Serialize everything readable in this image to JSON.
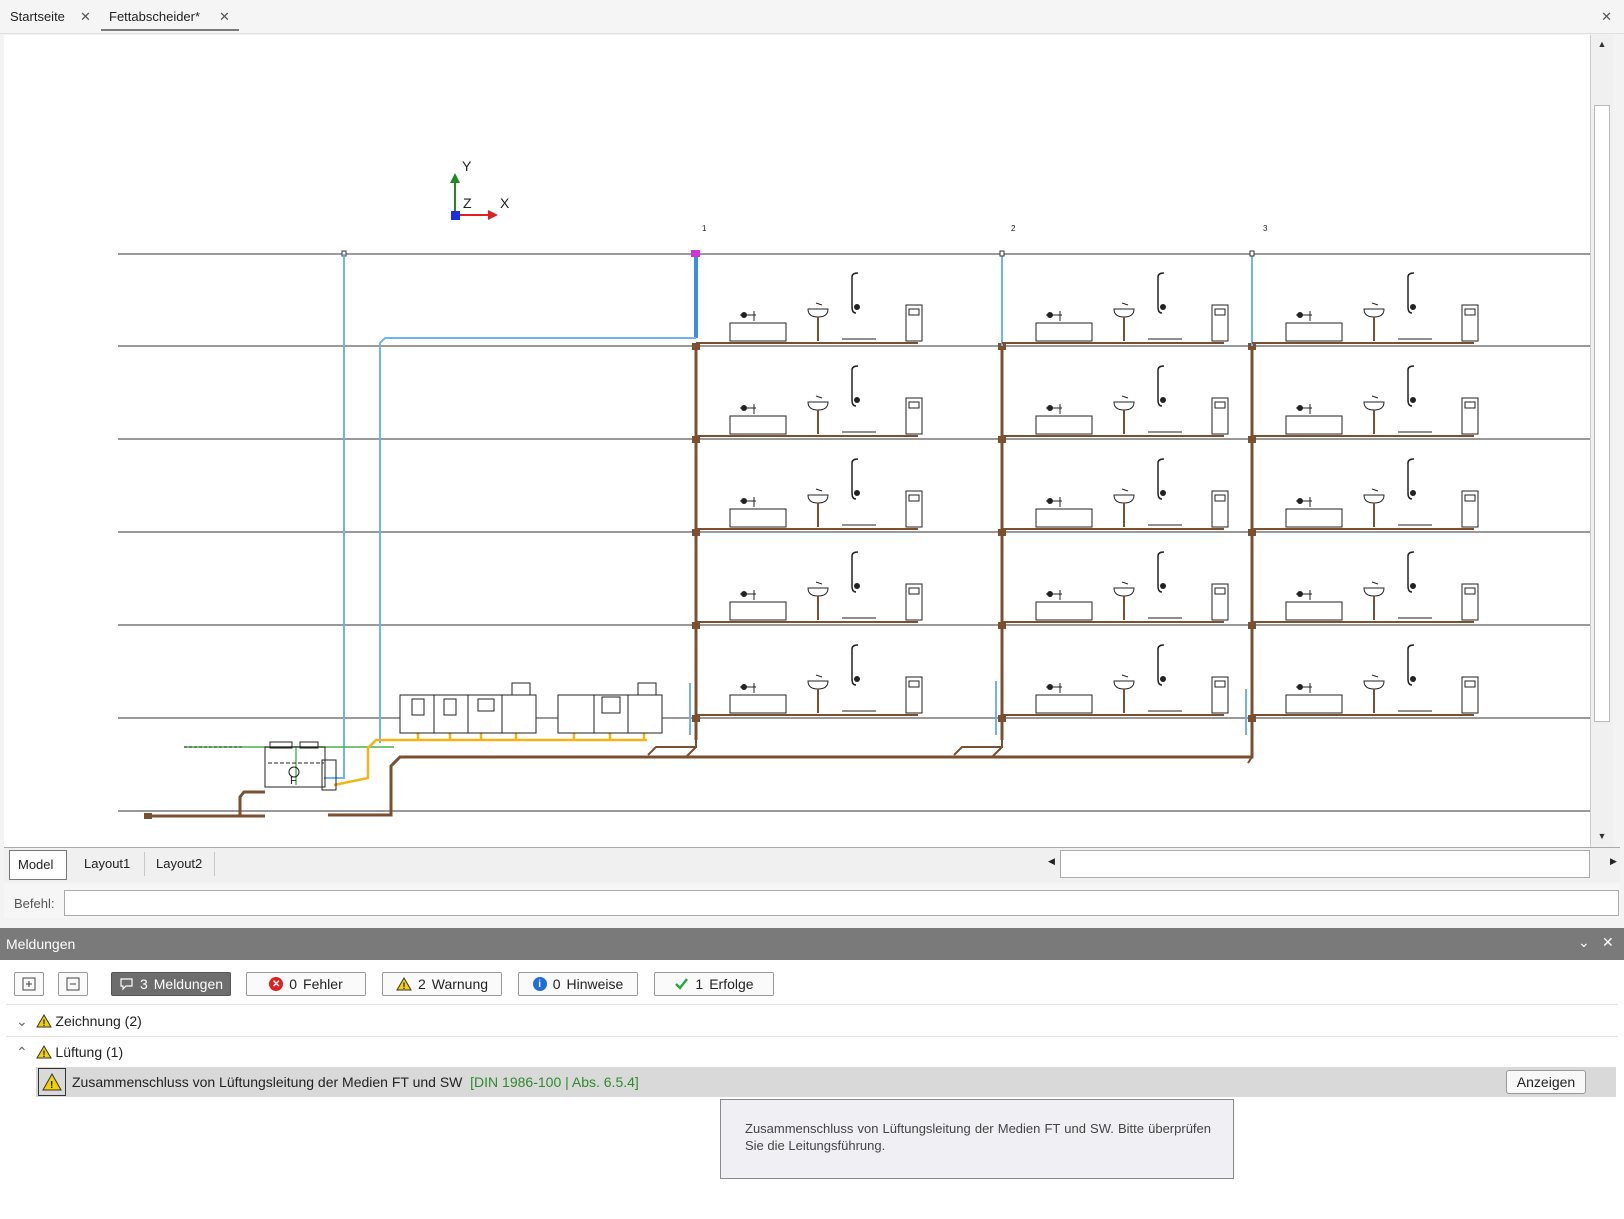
{
  "tabs": [
    {
      "label": "Startseite",
      "close": "✕"
    },
    {
      "label": "Fettabscheider*",
      "close": "✕"
    }
  ],
  "window_close": "✕",
  "drawing": {
    "axis_labels": {
      "y": "Y",
      "x": "X",
      "z": "Z"
    },
    "column_labels": [
      "1",
      "2",
      "3"
    ],
    "separator_label": "F",
    "colors": {
      "water": "#6fb4ee",
      "drain": "#7a5030",
      "gas": "#f2b416",
      "vent": "#49b249",
      "marker": "#d633d6"
    }
  },
  "layout_tabs": [
    "Model",
    "Layout1",
    "Layout2"
  ],
  "command": {
    "label": "Befehl:",
    "value": ""
  },
  "messages_panel": {
    "title": "Meldungen",
    "filters": [
      {
        "count": "3",
        "label": "Meldungen",
        "icon": "speech-bubble-icon"
      },
      {
        "count": "0",
        "label": "Fehler",
        "icon": "error-icon"
      },
      {
        "count": "2",
        "label": "Warnung",
        "icon": "warning-icon"
      },
      {
        "count": "0",
        "label": "Hinweise",
        "icon": "info-icon"
      },
      {
        "count": "1",
        "label": "Erfolge",
        "icon": "check-icon"
      }
    ],
    "groups": [
      {
        "label": "Zeichnung (2)",
        "expanded": false
      },
      {
        "label": "Lüftung (1)",
        "expanded": true
      }
    ],
    "message": {
      "text": "Zusammenschluss von Lüftungsleitung der Medien FT und SW",
      "reference": "[DIN 1986-100 | Abs. 6.5.4]",
      "button": "Anzeigen"
    },
    "tooltip": "Zusammenschluss von Lüftungsleitung der Medien FT und SW. Bitte überprüfen Sie die Leitungsführung."
  }
}
